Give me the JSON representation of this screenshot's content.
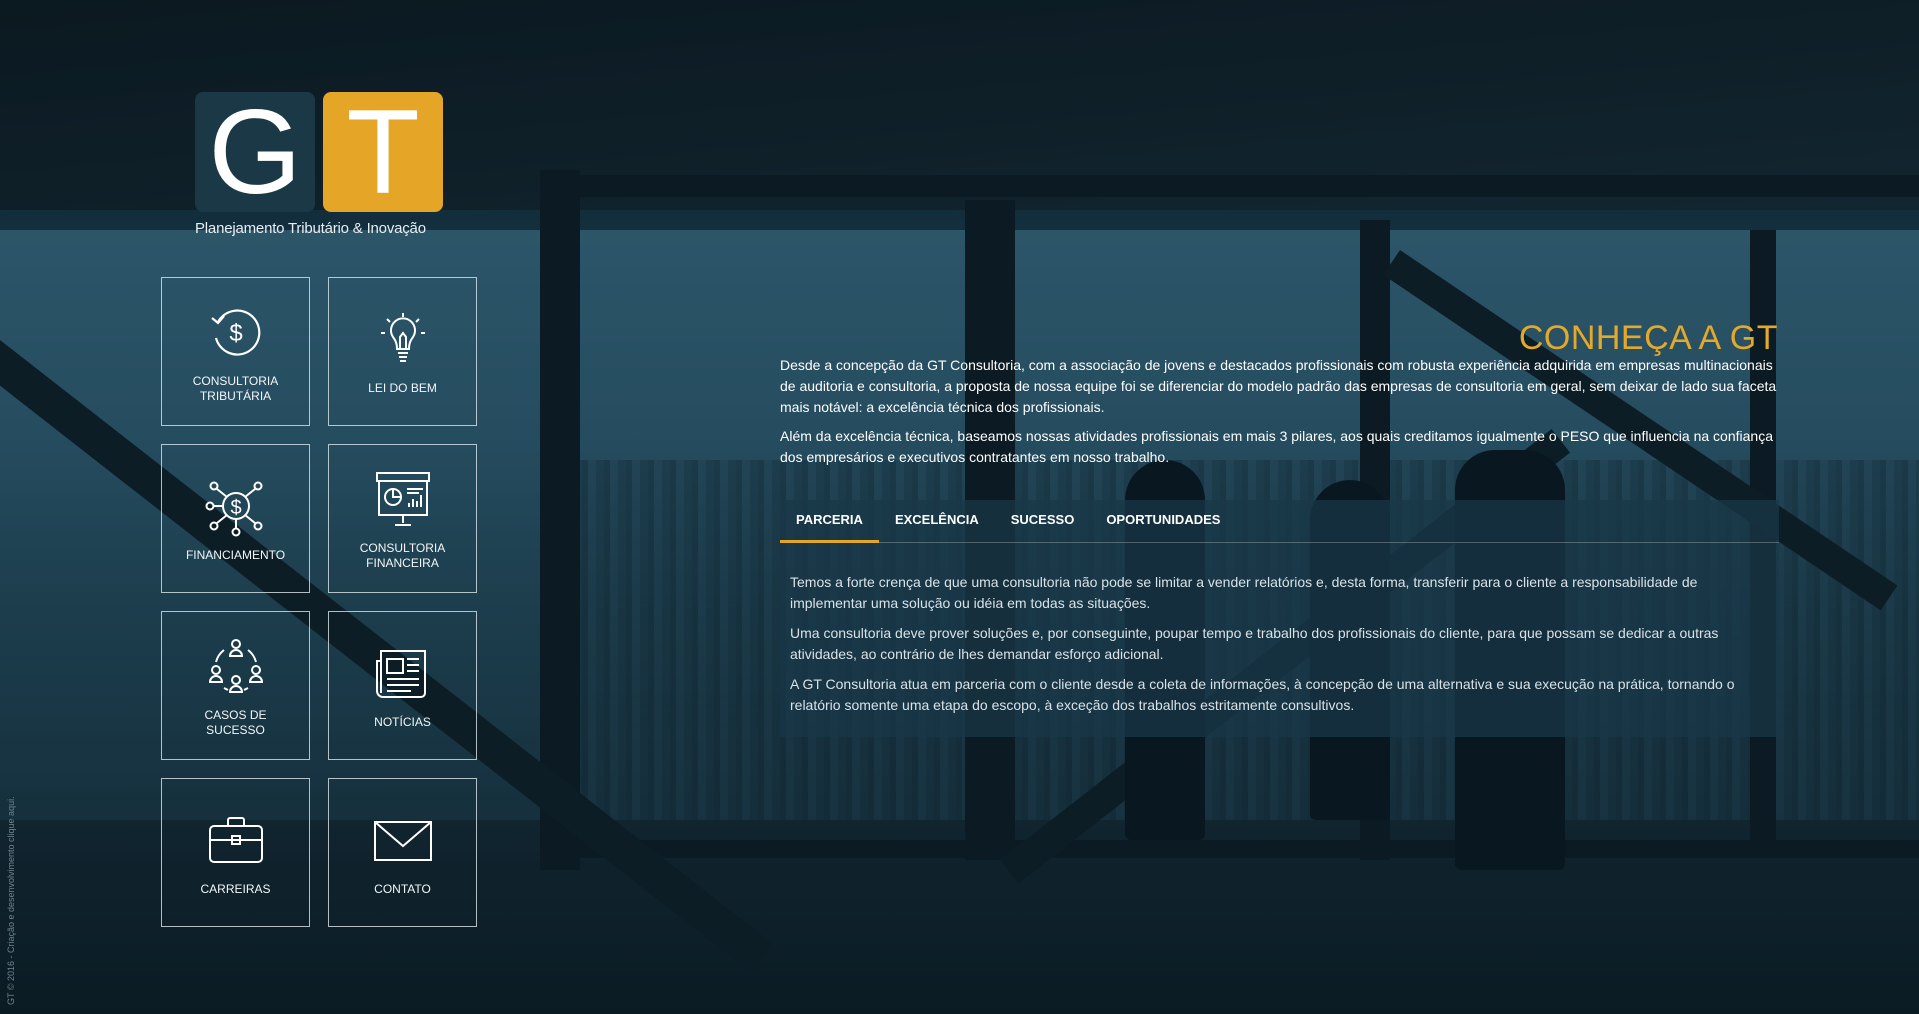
{
  "logo": {
    "letter_g": "G",
    "letter_t": "T",
    "tagline": "Planejamento Tributário & Inovação",
    "colors": {
      "g_bg": "#1b3847",
      "t_bg": "#e5a526"
    }
  },
  "tiles": [
    {
      "label": "CONSULTORIA\nTRIBUTÁRIA",
      "icon": "dollar-refresh-icon"
    },
    {
      "label": "LEI DO BEM",
      "icon": "lightbulb-icon"
    },
    {
      "label": "FINANCIAMENTO",
      "icon": "dollar-network-icon"
    },
    {
      "label": "CONSULTORIA\nFINANCEIRA",
      "icon": "presentation-chart-icon"
    },
    {
      "label": "CASOS DE\nSUCESSO",
      "icon": "people-circle-icon"
    },
    {
      "label": "NOTÍCIAS",
      "icon": "newspaper-icon"
    },
    {
      "label": "CARREIRAS",
      "icon": "briefcase-icon"
    },
    {
      "label": "CONTATO",
      "icon": "envelope-icon"
    }
  ],
  "main": {
    "title": "CONHEÇA A GT",
    "intro": [
      "Desde a concepção da GT Consultoria, com a associação de jovens e destacados profissionais com robusta experiência adquirida em empresas multinacionais de auditoria e consultoria, a proposta de nossa equipe foi se diferenciar do modelo padrão das empresas de consultoria em geral, sem deixar de lado sua faceta mais notável: a excelência técnica dos profissionais.",
      "Além da excelência técnica, baseamos nossas atividades profissionais em mais 3 pilares, aos quais creditamos igualmente o PESO que influencia na confiança dos empresários e executivos contratantes em nosso trabalho."
    ],
    "tabs": [
      {
        "label": "PARCERIA",
        "active": true
      },
      {
        "label": "EXCELÊNCIA",
        "active": false
      },
      {
        "label": "SUCESSO",
        "active": false
      },
      {
        "label": "OPORTUNIDADES",
        "active": false
      }
    ],
    "tab_content": [
      "Temos a forte crença de que uma consultoria não pode se limitar a vender relatórios e, desta forma, transferir para o cliente a responsabilidade de implementar uma solução ou idéia em todas as situações.",
      "Uma consultoria deve prover soluções e, por conseguinte, poupar tempo e trabalho dos profissionais do cliente, para que possam se dedicar a outras atividades, ao contrário de lhes demandar esforço adicional.",
      "A GT Consultoria atua em parceria com o cliente desde a coleta de informações, à concepção de uma alternativa e sua execução na prática, tornando o relatório somente uma etapa do escopo, à exceção dos trabalhos estritamente consultivos."
    ],
    "accent_color": "#e5a526"
  },
  "footer": {
    "credit": "GT © 2016 - Criação e desenvolvimento clique aqui."
  }
}
